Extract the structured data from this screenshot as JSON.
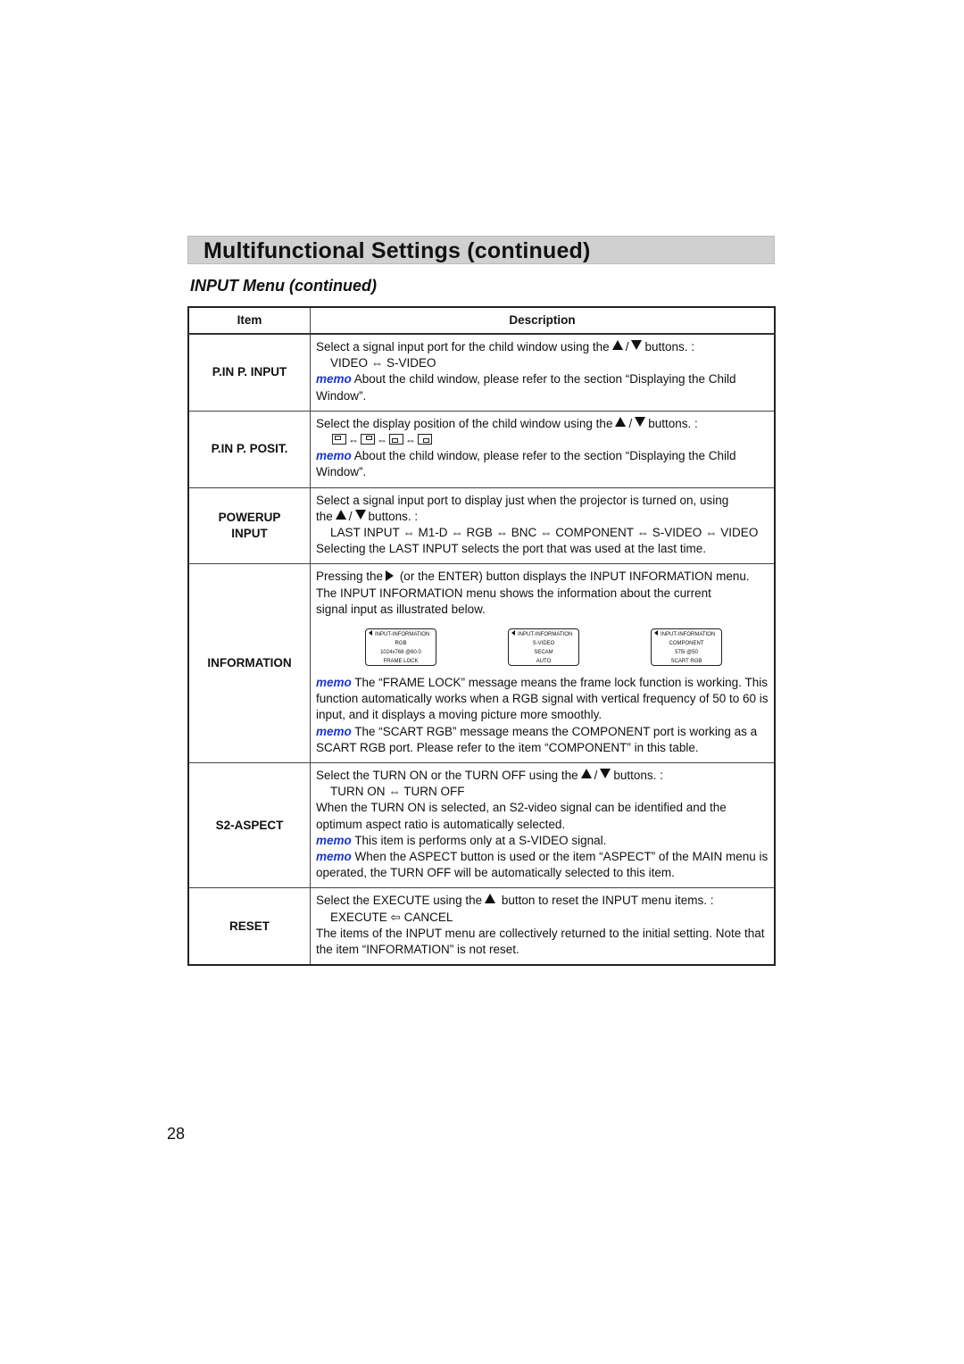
{
  "header": {
    "title": "Multifunctional Settings (continued)",
    "subtitle": "INPUT Menu (continued)"
  },
  "table": {
    "columns": [
      "Item",
      "Description"
    ],
    "memo_label": "memo",
    "rows": [
      {
        "item": "P.IN P. INPUT",
        "line1_pre": "Select a signal input port for the child window using the",
        "line1_post": "buttons. :",
        "options": "VIDEO ⇔ S-VIDEO",
        "memo": "About the child window, please refer to the section “Displaying the Child Window”."
      },
      {
        "item": "P.IN P. POSIT.",
        "line1_pre": "Select the display position of the child window using the",
        "line1_post": "buttons. :",
        "position_icons": [
          "top-left-icon",
          "top-right-icon",
          "bottom-left-icon",
          "bottom-right-icon"
        ],
        "memo": "About the child window, please refer to the section “Displaying the Child Window”."
      },
      {
        "item_line1": "POWERUP",
        "item_line2": "INPUT",
        "line1": "Select a signal input port to display just when the projector is turned on, using",
        "line2_pre": "the",
        "line2_post": "buttons. :",
        "options": "LAST INPUT ⇔ M1-D ⇔ RGB ⇔ BNC ⇔ COMPONENT ⇔ S-VIDEO ⇔ VIDEO",
        "note": "Selecting the LAST INPUT selects the port that was used at the last time."
      },
      {
        "item": "INFORMATION",
        "line1_pre": "Pressing the",
        "line1_post": "(or the ENTER) button displays the INPUT INFORMATION menu.",
        "line2": "The INPUT INFORMATION menu shows the information about the current signal input as illustrated below.",
        "osd_screens": [
          {
            "header": "INPUT-INFORMATION",
            "lines": [
              "RGB",
              "1024x768 @60.0",
              "FRAME LOCK"
            ]
          },
          {
            "header": "INPUT-INFORMATION",
            "lines": [
              "S-VIDEO",
              "SECAM",
              "AUTO"
            ]
          },
          {
            "header": "INPUT-INFORMATION",
            "lines": [
              "COMPONENT",
              "575i @50",
              "SCART RGB"
            ]
          }
        ],
        "memo1": "The “FRAME LOCK” message means the frame lock function is working. This function automatically works when a RGB signal with vertical frequency of 50 to 60 is input, and it displays a moving picture more smoothly.",
        "memo2": "The “SCART RGB” message means the COMPONENT port is working as a SCART RGB port. Please refer to the item “COMPONENT” in this table."
      },
      {
        "item": "S2-ASPECT",
        "line1_pre": "Select the TURN ON or the TURN OFF using the",
        "line1_post": "buttons. :",
        "options": "TURN ON ⇔ TURN OFF",
        "note": "When the TURN ON is selected, an S2-video signal can be identified and the optimum aspect ratio is automatically selected.",
        "memo1": "This item is performs only at a S-VIDEO signal.",
        "memo2": "When the ASPECT button is used or the item “ASPECT” of the MAIN menu is operated, the TURN OFF will be automatically selected to this item."
      },
      {
        "item": "RESET",
        "line1_pre": "Select the EXECUTE using the",
        "line1_post": "button to reset the INPUT menu items. :",
        "options": "EXECUTE ⇦ CANCEL",
        "note": "The items of the INPUT menu are collectively returned to the initial setting. Note that the item “INFORMATION” is not reset."
      }
    ]
  },
  "footer": {
    "page_number": "28"
  },
  "colors": {
    "memo": "#1a36c8",
    "title_bar": "#d0d0d0"
  }
}
